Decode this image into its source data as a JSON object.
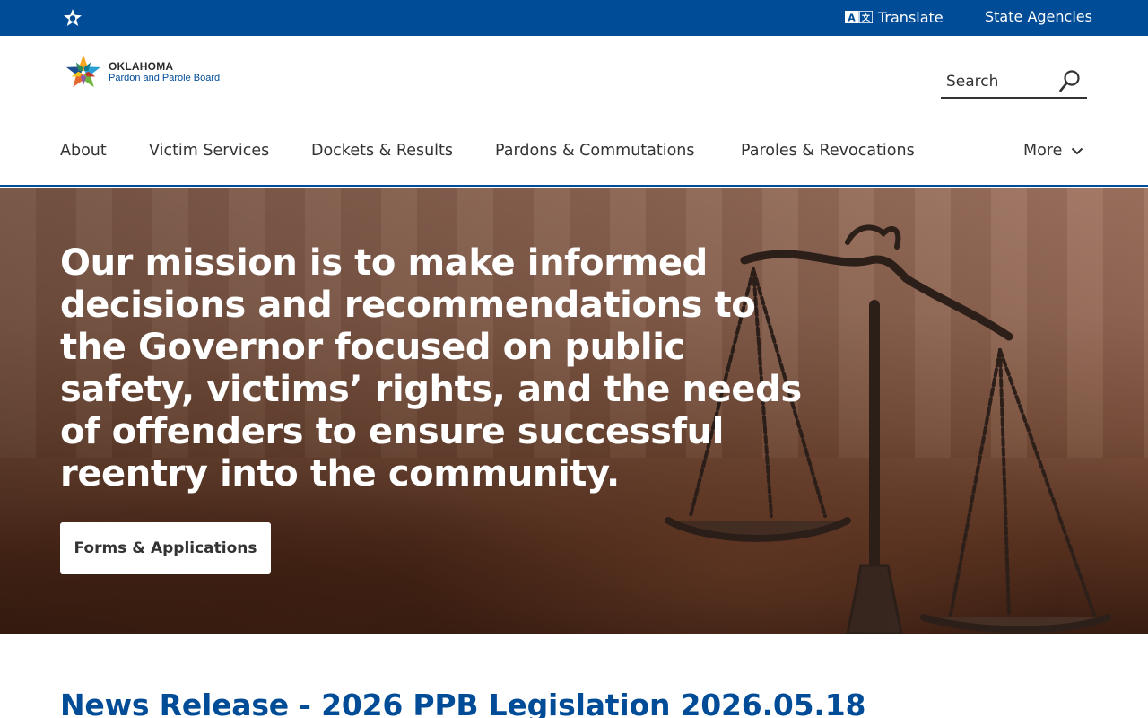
{
  "topbar": {
    "translate_label": "Translate",
    "state_agencies_label": "State Agencies",
    "background_color": "#004c97"
  },
  "logo": {
    "state": "OKLAHOMA",
    "agency": "Pardon and Parole Board"
  },
  "search": {
    "placeholder": "Search",
    "value": ""
  },
  "nav": {
    "items": [
      {
        "label": "About"
      },
      {
        "label": "Victim Services"
      },
      {
        "label": "Dockets & Results"
      },
      {
        "label": "Pardons & Commutations"
      },
      {
        "label": "Paroles & Revocations"
      }
    ],
    "more_label": "More"
  },
  "hero": {
    "mission": "Our mission is to make informed decisions and recommendations to the Governor focused on public safety, victims’ rights, and the needs of offenders to ensure successful reentry into the community.",
    "cta_label": "Forms & Applications"
  },
  "news": {
    "headline": "News Release - 2026 PPB Legislation 2026.05.18"
  },
  "colors": {
    "brand_blue": "#004c97",
    "text_dark": "#333333"
  }
}
